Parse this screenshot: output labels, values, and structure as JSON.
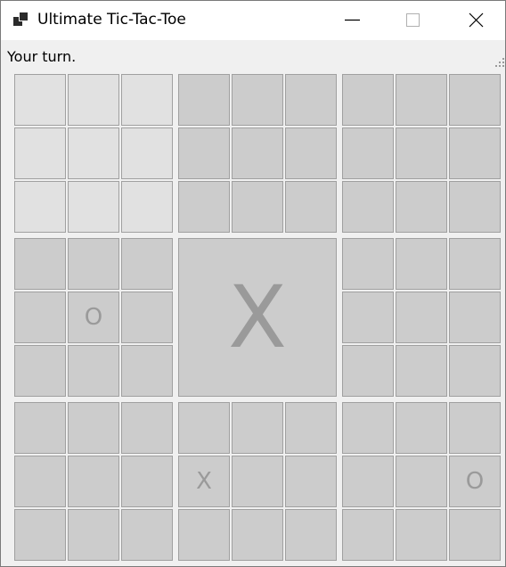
{
  "window": {
    "title": "Ultimate Tic-Tac-Toe",
    "status": "Your turn."
  },
  "colors": {
    "active_cell": "#e1e1e1",
    "inactive_cell": "#cccccc",
    "mark": "#9a9a9a"
  },
  "board": {
    "active_board": 0,
    "boards": [
      {
        "winner": "",
        "cells": [
          "",
          "",
          "",
          "",
          "",
          "",
          "",
          "",
          ""
        ]
      },
      {
        "winner": "",
        "cells": [
          "",
          "",
          "",
          "",
          "",
          "",
          "",
          "",
          ""
        ]
      },
      {
        "winner": "",
        "cells": [
          "",
          "",
          "",
          "",
          "",
          "",
          "",
          "",
          ""
        ]
      },
      {
        "winner": "",
        "cells": [
          "",
          "",
          "",
          "",
          "O",
          "",
          "",
          "",
          ""
        ]
      },
      {
        "winner": "X",
        "cells": [
          "",
          "",
          "",
          "",
          "",
          "",
          "",
          "",
          ""
        ]
      },
      {
        "winner": "",
        "cells": [
          "",
          "",
          "",
          "",
          "",
          "",
          "",
          "",
          ""
        ]
      },
      {
        "winner": "",
        "cells": [
          "",
          "",
          "",
          "",
          "",
          "",
          "",
          "",
          ""
        ]
      },
      {
        "winner": "",
        "cells": [
          "",
          "",
          "",
          "X",
          "",
          "",
          "",
          "",
          ""
        ]
      },
      {
        "winner": "",
        "cells": [
          "",
          "",
          "",
          "",
          "",
          "O",
          "",
          "",
          ""
        ]
      }
    ]
  }
}
